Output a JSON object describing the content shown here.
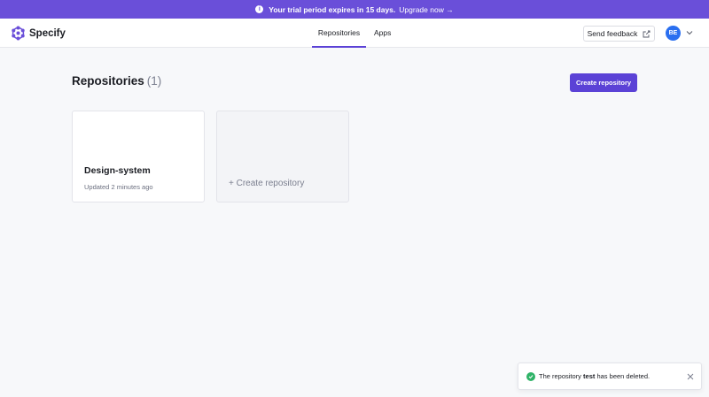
{
  "banner": {
    "message": "Your trial period expires in 15 days.",
    "link": "Upgrade now →",
    "info_glyph": "i"
  },
  "header": {
    "brand": "Specify",
    "tabs": [
      {
        "label": "Repositories",
        "active": true
      },
      {
        "label": "Apps",
        "active": false
      }
    ],
    "feedback_label": "Send feedback",
    "avatar_initials": "BE"
  },
  "main": {
    "title": "Repositories",
    "count": "(1)",
    "create_button": "Create repository",
    "repositories": [
      {
        "name": "Design-system",
        "updated": "Updated 2 minutes ago"
      }
    ],
    "create_card_label": "+ Create repository"
  },
  "toast": {
    "prefix": "The repository",
    "repo": "test",
    "suffix": "has been deleted."
  },
  "colors": {
    "brand": "#5b42d6",
    "banner": "#6a4fd9",
    "avatar": "#2a6ff0",
    "success": "#2fb367"
  }
}
